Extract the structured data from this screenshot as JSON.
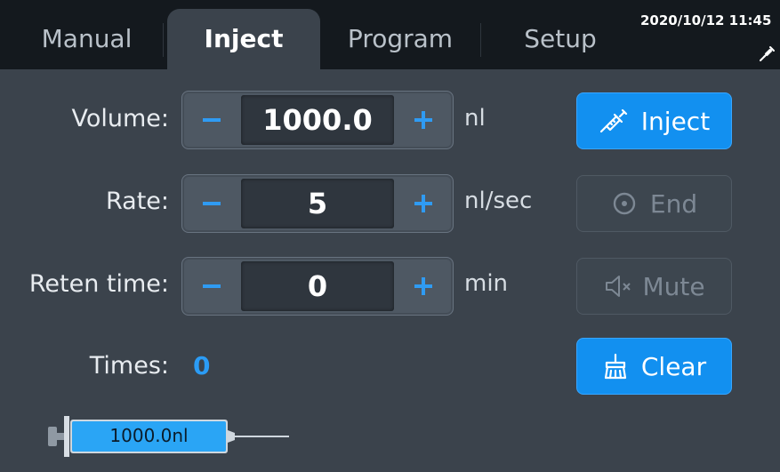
{
  "tabs": [
    {
      "label": "Manual"
    },
    {
      "label": "Inject"
    },
    {
      "label": "Program"
    },
    {
      "label": "Setup"
    }
  ],
  "active_tab": "Inject",
  "datetime": "2020/10/12 11:45",
  "fields": {
    "volume": {
      "label": "Volume:",
      "value": "1000.0",
      "unit": "nl"
    },
    "rate": {
      "label": "Rate:",
      "value": "5",
      "unit": "nl/sec"
    },
    "reten_time": {
      "label": "Reten time:",
      "value": "0",
      "unit": "min"
    }
  },
  "stepper_glyphs": {
    "minus": "−",
    "plus": "+"
  },
  "actions": {
    "inject": {
      "label": "Inject",
      "icon": "syringe-icon",
      "enabled": true
    },
    "end": {
      "label": "End",
      "icon": "stop-circle-icon",
      "enabled": false
    },
    "mute": {
      "label": "Mute",
      "icon": "speaker-mute-icon",
      "enabled": false
    },
    "clear": {
      "label": "Clear",
      "icon": "broom-icon",
      "enabled": true
    }
  },
  "times": {
    "label": "Times:",
    "value": "0"
  },
  "syringe": {
    "label": "1000.0nl",
    "fill_fraction": 1.0
  },
  "colors": {
    "background": "#3b434c",
    "tabbar": "#14191e",
    "accent_blue": "#1290f0",
    "disabled_text": "#7d8894",
    "times_value": "#2b9cf5"
  }
}
